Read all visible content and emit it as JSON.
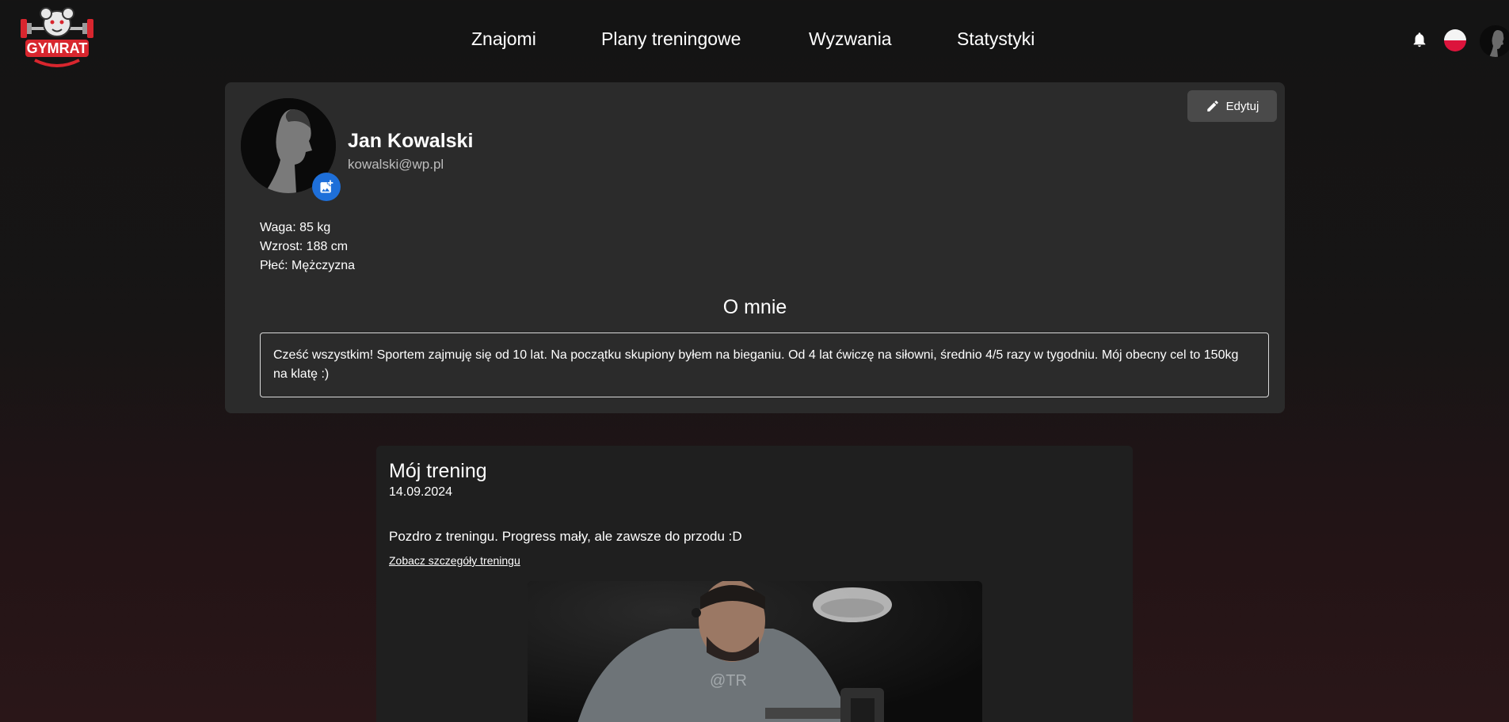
{
  "app": {
    "logo_text": "GYMRAT"
  },
  "nav": {
    "items": [
      "Znajomi",
      "Plany treningowe",
      "Wyzwania",
      "Statystyki"
    ]
  },
  "header_icons": [
    "bell-icon",
    "language-flag-pl",
    "user-avatar"
  ],
  "profile": {
    "edit_label": "Edytuj",
    "name": "Jan Kowalski",
    "email": "kowalski@wp.pl",
    "weight": "Waga: 85 kg",
    "height": "Wzrost: 188 cm",
    "gender": "Płeć: Mężczyzna",
    "about_title": "O mnie",
    "about_text": "Cześć wszystkim! Sportem zajmuję się od 10 lat. Na początku skupiony byłem na bieganiu. Od 4 lat ćwiczę na siłowni, średnio 4/5 razy w tygodniu. Mój obecny cel to 150kg na klatę :)"
  },
  "post": {
    "title": "Mój trening",
    "date": "14.09.2024",
    "text": "Pozdro z treningu. Progress mały, ale zawsze do przodu :D",
    "link_label": "Zobacz szczegóły treningu"
  },
  "colors": {
    "card_bg": "#2b2b2b",
    "post_bg": "#1f1f1f",
    "accent_blue": "#1e6fd9",
    "edit_button": "#4a4a4a",
    "logo_red": "#d8262e"
  }
}
